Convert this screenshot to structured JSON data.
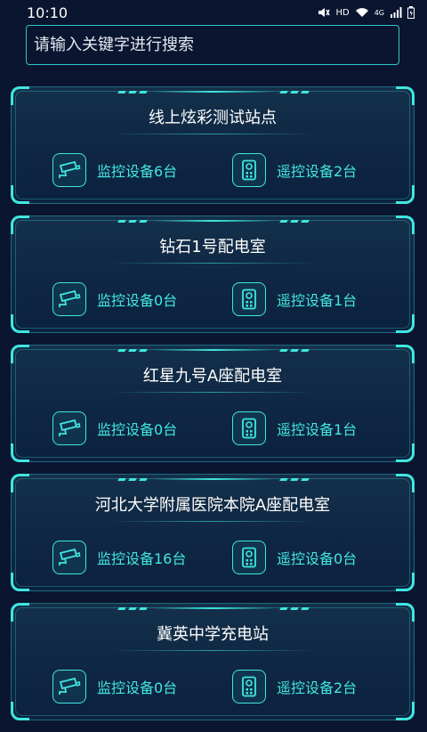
{
  "status_bar": {
    "time": "10:10",
    "network_label": "HD",
    "network_type": "4G"
  },
  "search": {
    "placeholder": "请输入关键字进行搜索",
    "value": ""
  },
  "colors": {
    "background": "#0a1530",
    "accent": "#3fe7e0",
    "text_accent": "#42e8e0"
  },
  "sites": [
    {
      "name": "线上炫彩测试站点",
      "monitor": "监控设备6台",
      "remote": "遥控设备2台"
    },
    {
      "name": "钻石1号配电室",
      "monitor": "监控设备0台",
      "remote": "遥控设备1台"
    },
    {
      "name": "红星九号A座配电室",
      "monitor": "监控设备0台",
      "remote": "遥控设备1台"
    },
    {
      "name": "河北大学附属医院本院A座配电室",
      "monitor": "监控设备16台",
      "remote": "遥控设备0台"
    },
    {
      "name": "冀英中学充电站",
      "monitor": "监控设备0台",
      "remote": "遥控设备2台"
    }
  ],
  "icons": {
    "monitor": "cctv-camera-icon",
    "remote": "remote-control-icon"
  }
}
